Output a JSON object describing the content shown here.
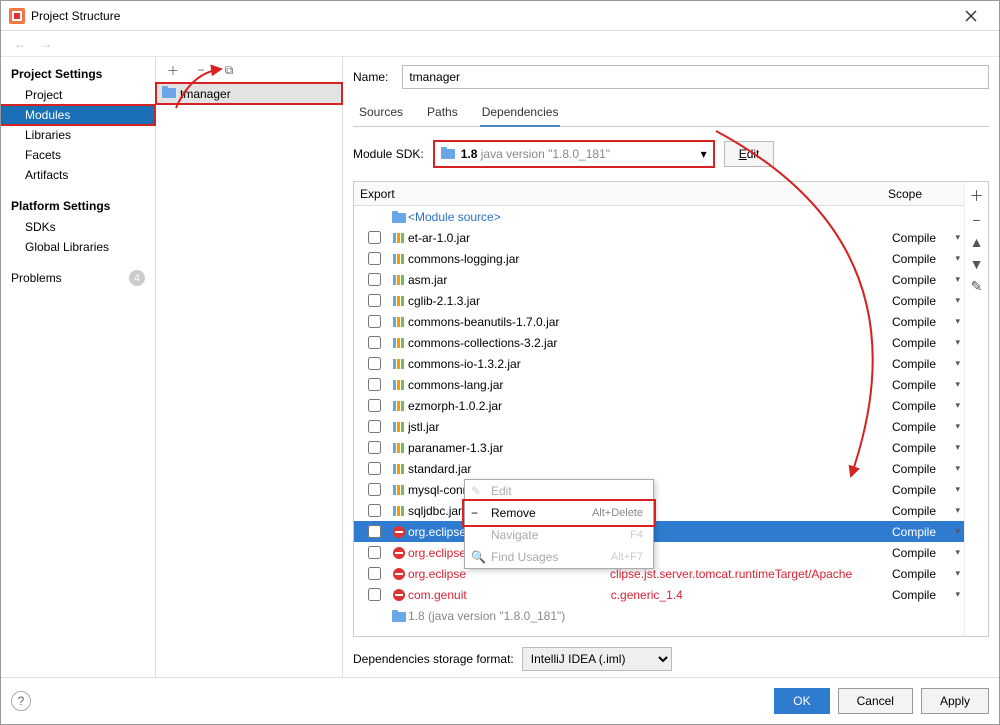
{
  "window": {
    "title": "Project Structure"
  },
  "sidebar": {
    "heading1": "Project Settings",
    "items1": [
      "Project",
      "Modules",
      "Libraries",
      "Facets",
      "Artifacts"
    ],
    "heading2": "Platform Settings",
    "items2": [
      "SDKs",
      "Global Libraries"
    ],
    "problems": "Problems",
    "problems_count": "4"
  },
  "module": {
    "name": "tmanager"
  },
  "name_label": "Name:",
  "name_value": "tmanager",
  "tabs": [
    "Sources",
    "Paths",
    "Dependencies"
  ],
  "sdk_label": "Module SDK:",
  "sdk_value_strong": "1.8",
  "sdk_value_gray": "java version \"1.8.0_181\"",
  "edit_label": "Edit",
  "columns": {
    "export": "Export",
    "scope": "Scope"
  },
  "module_source": "<Module source>",
  "deps": [
    {
      "name": "et-ar-1.0.jar",
      "scope": "Compile",
      "type": "jar"
    },
    {
      "name": "commons-logging.jar",
      "scope": "Compile",
      "type": "jar"
    },
    {
      "name": "asm.jar",
      "scope": "Compile",
      "type": "jar"
    },
    {
      "name": "cglib-2.1.3.jar",
      "scope": "Compile",
      "type": "jar"
    },
    {
      "name": "commons-beanutils-1.7.0.jar",
      "scope": "Compile",
      "type": "jar"
    },
    {
      "name": "commons-collections-3.2.jar",
      "scope": "Compile",
      "type": "jar"
    },
    {
      "name": "commons-io-1.3.2.jar",
      "scope": "Compile",
      "type": "jar"
    },
    {
      "name": "commons-lang.jar",
      "scope": "Compile",
      "type": "jar"
    },
    {
      "name": "ezmorph-1.0.2.jar",
      "scope": "Compile",
      "type": "jar"
    },
    {
      "name": "jstl.jar",
      "scope": "Compile",
      "type": "jar"
    },
    {
      "name": "paranamer-1.3.jar",
      "scope": "Compile",
      "type": "jar"
    },
    {
      "name": "standard.jar",
      "scope": "Compile",
      "type": "jar"
    },
    {
      "name": "mysql-connector-java-5.0.3-bin.jar",
      "scope": "Compile",
      "type": "jar"
    },
    {
      "name": "sqljdbc.jar",
      "scope": "Compile",
      "type": "jar"
    },
    {
      "name": "org.eclipse",
      "scope": "Compile",
      "type": "err",
      "selected": true
    },
    {
      "name": "org.eclipse",
      "tail": "er",
      "scope": "Compile",
      "type": "err"
    },
    {
      "name": "org.eclipse",
      "tail": "clipse.jst.server.tomcat.runtimeTarget/Apache",
      "scope": "Compile",
      "type": "err"
    },
    {
      "name": "com.genuit",
      "tail": "c.generic_1.4",
      "scope": "Compile",
      "type": "err"
    },
    {
      "name": "1.8 (java version \"1.8.0_181\")",
      "scope": "",
      "type": "sdk"
    }
  ],
  "context": {
    "edit": "Edit",
    "remove": "Remove",
    "remove_sc": "Alt+Delete",
    "navigate": "Navigate",
    "navigate_sc": "F4",
    "find": "Find Usages",
    "find_sc": "Alt+F7"
  },
  "storage_label": "Dependencies storage format:",
  "storage_value": "IntelliJ IDEA (.iml)",
  "footer": {
    "ok": "OK",
    "cancel": "Cancel",
    "apply": "Apply"
  }
}
